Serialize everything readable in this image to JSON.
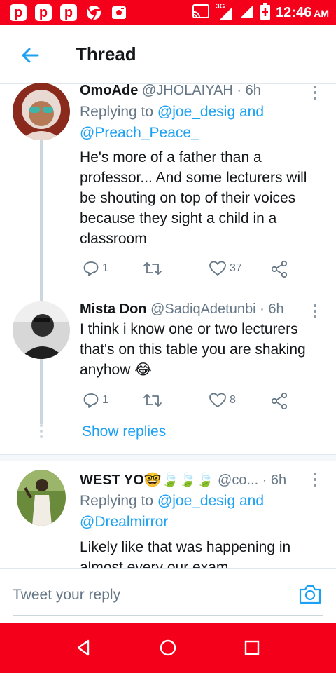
{
  "status_bar": {
    "left_icons": [
      "p",
      "p",
      "p",
      "p"
    ],
    "network": "3G",
    "time": "12:46",
    "ampm": "AM",
    "colors": {
      "background": "#f5001a"
    }
  },
  "header": {
    "title": "Thread",
    "back_icon": "arrow-left-icon",
    "accent": "#1da1f2"
  },
  "tweets": [
    {
      "name": "OmoAde",
      "handle": "@JHOLAIYAH",
      "time": " · 6h",
      "reply_prefix": "Replying to ",
      "reply_user1": "@joe_desig",
      "reply_and": " and",
      "reply_user2": "@Preach_Peace_",
      "text": "He's more of a father than a professor... And some lecturers will be shouting on top of their voices because they sight a child in a classroom",
      "replies": "1",
      "retweets": "",
      "likes": "37"
    },
    {
      "name": "Mista Don",
      "handle": "@SadiqAdetunbi",
      "time": " · 6h",
      "text": "I think i know one or two lecturers that's on this table you are shaking anyhow 😂",
      "replies": "1",
      "retweets": "",
      "likes": "8"
    },
    {
      "name": "WEST YO🤓🍃🍃🍃",
      "handle": " @co...",
      "time": " · 6h",
      "reply_prefix": "Replying to ",
      "reply_user1": "@joe_desig",
      "reply_and": " and",
      "reply_user2": "@Drealmirror",
      "text": "Likely like that was happening in almost every our exam"
    }
  ],
  "show_replies": "Show replies",
  "compose": {
    "placeholder": "Tweet your reply",
    "camera_icon": "camera-icon"
  },
  "nav_bar": {
    "icons": [
      "back-triangle-icon",
      "home-circle-icon",
      "recents-square-icon"
    ]
  }
}
